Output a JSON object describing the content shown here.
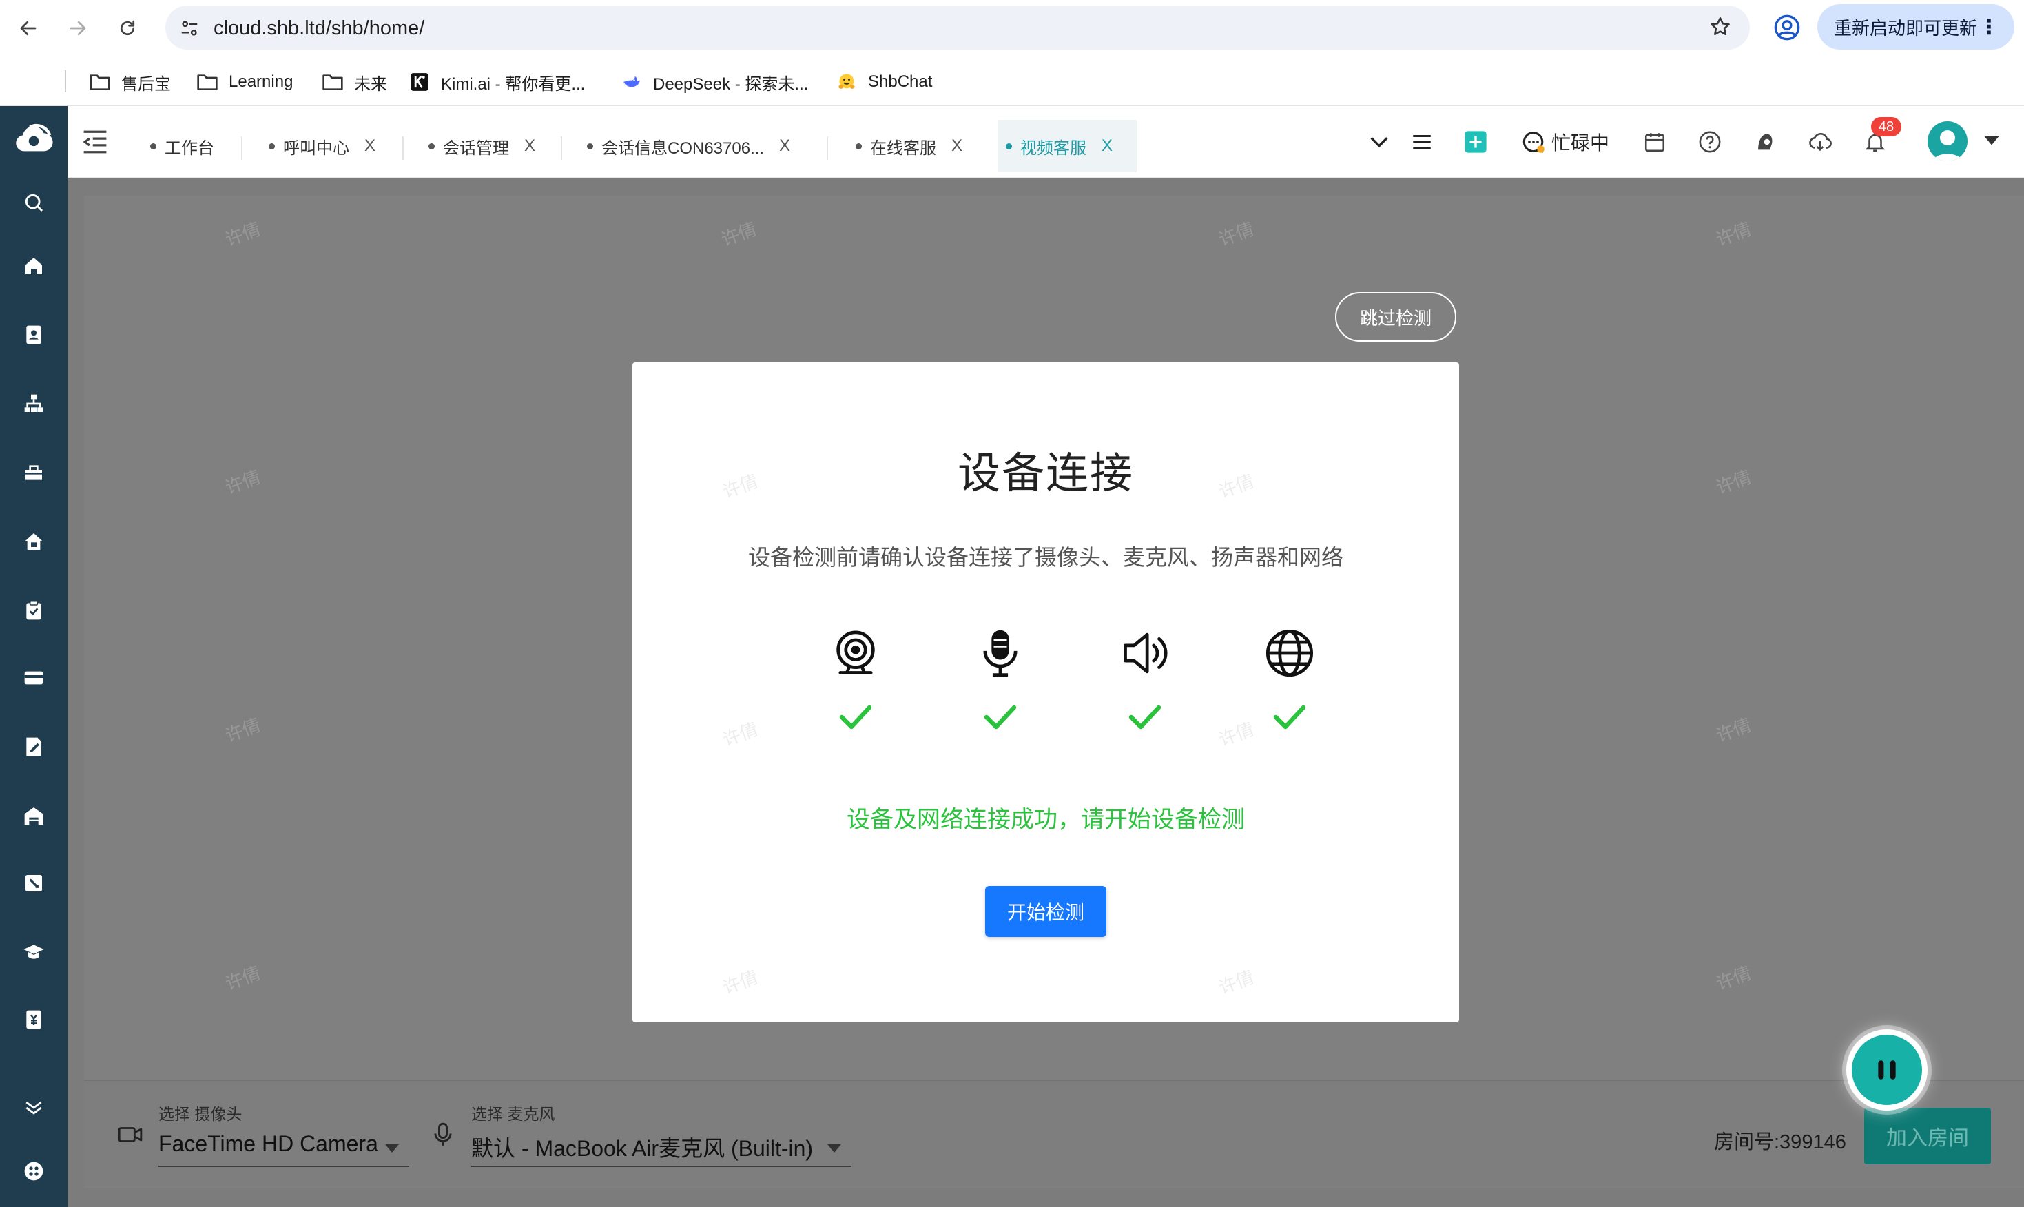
{
  "browser": {
    "url": "cloud.shb.ltd/shb/home/",
    "update_label": "重新启动即可更新",
    "menu_glyph": "⋮"
  },
  "bookmarks": [
    {
      "label": "售后宝",
      "icon": "folder-icon"
    },
    {
      "label": "Learning",
      "icon": "folder-icon"
    },
    {
      "label": "未来",
      "icon": "folder-icon"
    },
    {
      "label": "Kimi.ai - 帮你看更...",
      "icon": "kimi-icon"
    },
    {
      "label": "DeepSeek - 探索未...",
      "icon": "deepseek-icon"
    },
    {
      "label": "ShbChat",
      "icon": "hugging-face-icon"
    }
  ],
  "tabs": [
    {
      "label": "工作台",
      "closable": false
    },
    {
      "label": "呼叫中心",
      "closable": true
    },
    {
      "label": "会话管理",
      "closable": true
    },
    {
      "label": "会话信息CON63706...",
      "closable": true
    },
    {
      "label": "在线客服",
      "closable": true
    },
    {
      "label": "视频客服",
      "closable": true,
      "active": true
    }
  ],
  "header": {
    "status_label": "忙碌中",
    "notification_count": "48",
    "close_glyph": "X"
  },
  "watermark_text": "许倩",
  "skip_label": "跳过检测",
  "dialog": {
    "title": "设备连接",
    "description": "设备检测前请确认设备连接了摄像头、麦克风、扬声器和网络",
    "devices": [
      "camera-icon",
      "microphone-icon",
      "speaker-icon",
      "network-globe-icon"
    ],
    "success_message": "设备及网络连接成功，请开始设备检测",
    "start_label": "开始检测"
  },
  "bottom": {
    "camera_label": "选择 摄像头",
    "camera_value": "FaceTime HD Camera",
    "mic_label": "选择 麦克风",
    "mic_value": "默认 - MacBook Air麦克风 (Built-in)",
    "room_label": "房间号:399146",
    "join_label": "加入房间"
  },
  "colors": {
    "sidebar": "#1f3d4f",
    "accent_teal": "#1a9ba5",
    "primary_blue": "#1677ff",
    "success_green": "#2bc23d",
    "badge_red": "#f0403a"
  }
}
